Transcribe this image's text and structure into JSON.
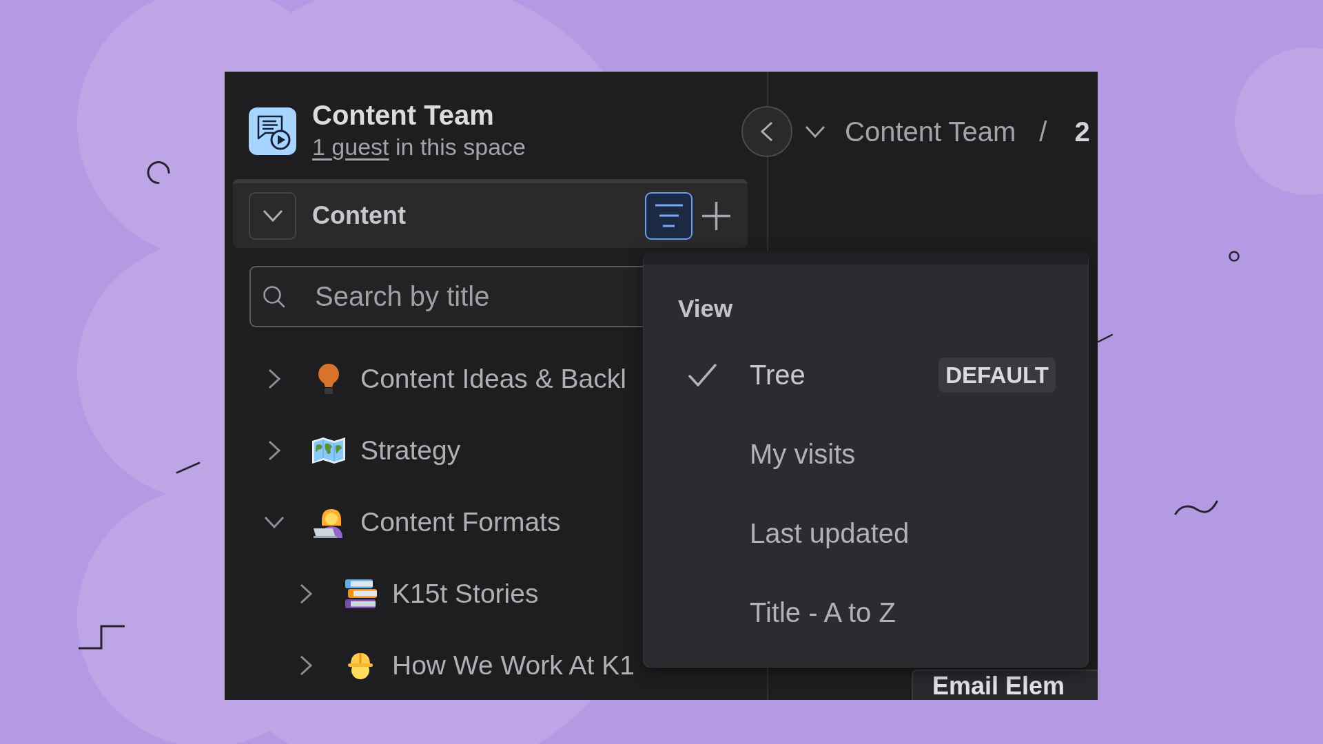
{
  "space": {
    "name": "Content Team",
    "guest_link": "1 guest",
    "guest_text": "in this space"
  },
  "content_bar": {
    "label": "Content",
    "expanded": true,
    "filter_active": true
  },
  "search": {
    "placeholder": "Search by title"
  },
  "tree": [
    {
      "label": "Content Ideas & Backl",
      "expanded": false
    },
    {
      "label": "Strategy",
      "expanded": false
    },
    {
      "label": "Content Formats",
      "expanded": true,
      "children": [
        {
          "label": "K15t Stories",
          "expanded": false
        },
        {
          "label": "How We Work At K1",
          "expanded": false
        }
      ]
    }
  ],
  "breadcrumb": {
    "items": [
      {
        "label": "Content Team",
        "current": false
      },
      {
        "label": "2",
        "current": true
      }
    ],
    "separator": "/"
  },
  "view_menu": {
    "title": "View",
    "options": [
      {
        "label": "Tree",
        "selected": true,
        "badge": "DEFAULT"
      },
      {
        "label": "My visits",
        "selected": false
      },
      {
        "label": "Last updated",
        "selected": false
      },
      {
        "label": "Title - A to Z",
        "selected": false
      }
    ]
  },
  "page_card": {
    "title": "Email Elem"
  }
}
